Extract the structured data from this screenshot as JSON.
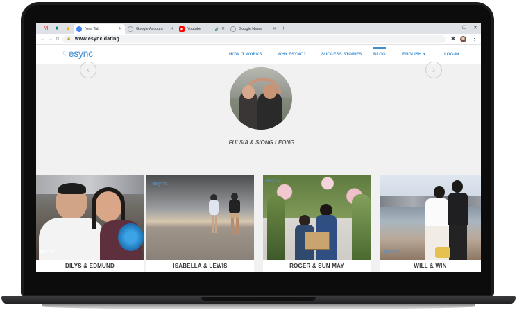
{
  "browser": {
    "tabs": [
      {
        "label": "New Tab",
        "icon": "chrome-icon",
        "active": true
      },
      {
        "label": "Google Account",
        "icon": "google-icon",
        "active": false
      },
      {
        "label": "Youtube",
        "icon": "youtube-icon",
        "active": false
      },
      {
        "label": "Google News",
        "icon": "news-icon",
        "active": false
      }
    ],
    "pinned_tabs": [
      "gmail-icon",
      "meet-icon",
      "drive-icon"
    ],
    "new_tab": "+",
    "window_controls": [
      "–",
      "☐",
      "✕"
    ],
    "url": "www.esync.dating"
  },
  "site": {
    "logo": "esync",
    "nav": [
      "HOW IT WORKS",
      "WHY ESYNC?",
      "SUCCESS STORIES",
      "BLOG",
      "ENGLISH",
      "LOG-IN"
    ],
    "accent": "#3e8ed0"
  },
  "hero": {
    "prev": "‹",
    "next": "›",
    "couple": "FUI SIA & SIONG LEONG"
  },
  "couples": [
    {
      "name": "DILYS & EDMUND",
      "watermark": "esync"
    },
    {
      "name": "ISABELLA & LEWIS",
      "watermark": "esync"
    },
    {
      "name": "ROGER & SUN MAY",
      "watermark": "esync"
    },
    {
      "name": "WILL & WIN",
      "watermark": "esync"
    }
  ]
}
